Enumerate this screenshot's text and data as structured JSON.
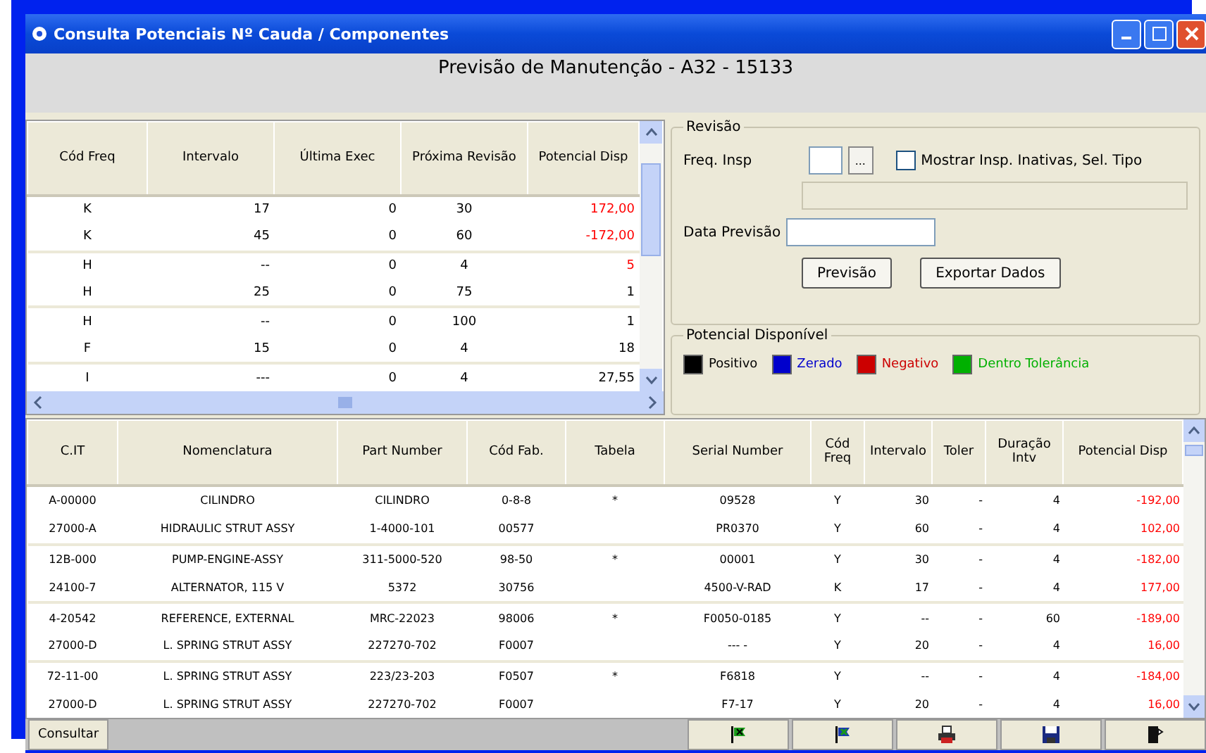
{
  "window": {
    "title": "Consulta Potenciais Nº Cauda / Componentes"
  },
  "heading": "Previsão de Manutenção - A32 - 15133",
  "top_table": {
    "columns": [
      "Cód Freq",
      "Intervalo",
      "Última Exec",
      "Próxima Revisão",
      "Potencial Disp"
    ],
    "rows": [
      {
        "cells": [
          "K",
          "17",
          "0",
          "30",
          "172,00"
        ],
        "negative": true
      },
      {
        "cells": [
          "K",
          "45",
          "0",
          "60",
          "-172,00"
        ],
        "negative": true
      },
      {
        "cells": [
          "H",
          "--",
          "0",
          "4",
          "5"
        ],
        "negative": true
      },
      {
        "cells": [
          "H",
          "25",
          "0",
          "75",
          "1"
        ],
        "negative": false
      },
      {
        "cells": [
          "H",
          "--",
          "0",
          "100",
          "1"
        ],
        "negative": false
      },
      {
        "cells": [
          "F",
          "15",
          "0",
          "4",
          "18"
        ],
        "negative": false
      },
      {
        "cells": [
          "I",
          "---",
          "0",
          "4",
          "27,55"
        ],
        "negative": false
      }
    ]
  },
  "revision": {
    "title": "Revisão",
    "freq_label": "Freq. Insp",
    "browse": "...",
    "inactive": {
      "label": "Mostrar Insp. Inativas, Sel. Tipo",
      "checked": false
    },
    "date_label": "Data Previsão",
    "buttons": [
      "Previsão",
      "Exportar Dados"
    ]
  },
  "legend": {
    "title": "Potencial Disponível",
    "items": [
      {
        "label": "Positivo",
        "color": "#000000"
      },
      {
        "label": "Zerado",
        "color": "#0000cc"
      },
      {
        "label": "Negativo",
        "color": "#cc0000"
      },
      {
        "label": "Dentro Tolerância",
        "color": "#00b000"
      }
    ]
  },
  "bottom_table": {
    "columns": [
      "C.IT",
      "Nomenclatura",
      "Part Number",
      "Cód Fab.",
      "Tabela",
      "Serial Number",
      "Cód Freq",
      "Intervalo",
      "Toler",
      "Duração Intv",
      "Potencial Disp"
    ],
    "rows": [
      {
        "cells": [
          "A-00000",
          "CILINDRO",
          "CILINDRO",
          "0-8-8",
          "*",
          "09528",
          "Y",
          "30",
          "-",
          "4",
          "-192,00"
        ]
      },
      {
        "cells": [
          "27000-A",
          "HIDRAULIC STRUT ASSY",
          "1-4000-101",
          "00577",
          "",
          "PR0370",
          "Y",
          "60",
          "-",
          "4",
          "102,00"
        ]
      },
      {
        "cells": [
          "12B-000",
          "PUMP-ENGINE-ASSY",
          "311-5000-520",
          "98-50",
          "*",
          "00001",
          "Y",
          "30",
          "-",
          "4",
          "-182,00"
        ]
      },
      {
        "cells": [
          "24100-7",
          "ALTERNATOR, 115 V",
          "5372",
          "30756",
          "",
          "4500-V-RAD",
          "K",
          "17",
          "-",
          "4",
          "177,00"
        ]
      },
      {
        "cells": [
          "4-20542",
          "REFERENCE, EXTERNAL",
          "MRC-22023",
          "98006",
          "*",
          "F0050-0185",
          "Y",
          "--",
          "-",
          "60",
          "-189,00"
        ]
      },
      {
        "cells": [
          "27000-D",
          "L. SPRING STRUT ASSY",
          "227270-702",
          "F0007",
          "",
          "--- -",
          "Y",
          "20",
          "-",
          "4",
          "16,00"
        ]
      },
      {
        "cells": [
          "72-11-00",
          "L. SPRING STRUT ASSY",
          "223/23-203",
          "F0507",
          "*",
          "F6818",
          "Y",
          "--",
          "-",
          "4",
          "-184,00"
        ]
      },
      {
        "cells": [
          "27000-D",
          "L. SPRING STRUT ASSY",
          "227270-702",
          "F0007",
          "",
          "F7-17",
          "Y",
          "20",
          "-",
          "4",
          "16,00"
        ]
      }
    ]
  },
  "footer": {
    "consult": "Consultar",
    "tools": [
      {
        "kind": "flag-green"
      },
      {
        "kind": "flag-blue"
      },
      {
        "kind": "printer"
      },
      {
        "kind": "save"
      },
      {
        "kind": "exit"
      }
    ]
  }
}
